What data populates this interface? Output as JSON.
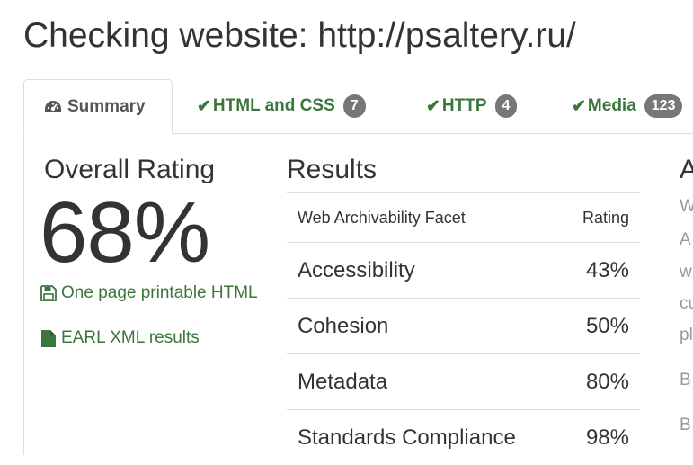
{
  "page": {
    "title": "Checking website: http://psaltery.ru/"
  },
  "tabs": [
    {
      "label": "Summary",
      "icon": "dashboard-icon",
      "active": true
    },
    {
      "label": "HTML and CSS",
      "icon": "check-icon",
      "badge": "7"
    },
    {
      "label": "HTTP",
      "icon": "check-icon",
      "badge": "4"
    },
    {
      "label": "Media",
      "icon": "check-icon",
      "badge": "123"
    }
  ],
  "overall": {
    "heading": "Overall Rating",
    "value": "68%",
    "links": [
      {
        "label": "One page printable HTML",
        "icon": "floppy-disk-icon"
      },
      {
        "label": "EARL XML results",
        "icon": "file-icon"
      }
    ]
  },
  "results": {
    "heading": "Results",
    "columns": [
      "Web Archivability Facet",
      "Rating"
    ],
    "rows": [
      {
        "facet": "Accessibility",
        "rating": "43%"
      },
      {
        "facet": "Cohesion",
        "rating": "50%"
      },
      {
        "facet": "Metadata",
        "rating": "80%"
      },
      {
        "facet": "Standards Compliance",
        "rating": "98%"
      }
    ]
  },
  "right_column": {
    "heading": "A",
    "lines": [
      "W",
      "A",
      "w",
      "cu",
      "pl",
      "B",
      "B"
    ]
  },
  "colors": {
    "success": "#3c763d",
    "badge": "#777777",
    "border": "#dddddd",
    "text": "#333333"
  }
}
